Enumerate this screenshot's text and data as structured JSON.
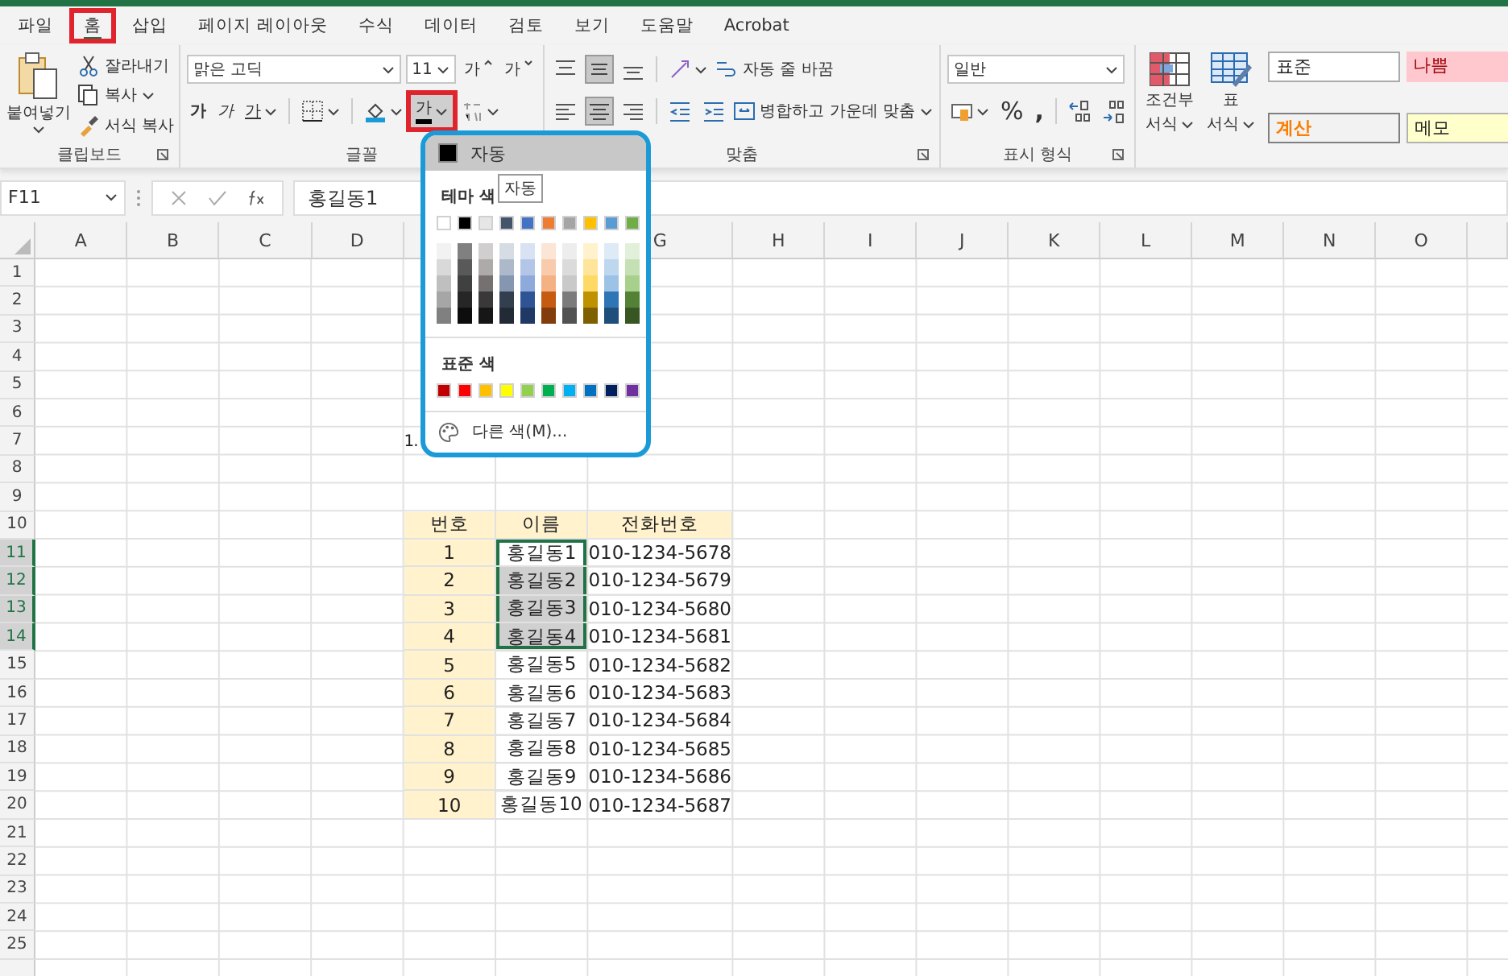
{
  "menu_tabs": [
    {
      "label": "파일",
      "selected": false
    },
    {
      "label": "홈",
      "selected": true
    },
    {
      "label": "삽입",
      "selected": false
    },
    {
      "label": "페이지 레이아웃",
      "selected": false
    },
    {
      "label": "수식",
      "selected": false
    },
    {
      "label": "데이터",
      "selected": false
    },
    {
      "label": "검토",
      "selected": false
    },
    {
      "label": "보기",
      "selected": false
    },
    {
      "label": "도움말",
      "selected": false
    },
    {
      "label": "Acrobat",
      "selected": false
    }
  ],
  "clipboard": {
    "paste": "붙여넣기",
    "cut": "잘라내기",
    "copy": "복사",
    "format_painter": "서식 복사",
    "group_label": "클립보드"
  },
  "font": {
    "font_name": "맑은 고딕",
    "font_size": "11",
    "grow": "가",
    "shrink": "가",
    "bold": "가",
    "italic": "가",
    "underline": "가",
    "font_color": "가",
    "group_label": "글꼴"
  },
  "alignment": {
    "wrap_text": "자동 줄 바꿈",
    "merge": "병합하고 가운데 맞춤",
    "group_label": "맞춤"
  },
  "number": {
    "format": "일반",
    "percent": "%",
    "comma": ",",
    "group_label": "표시 형식"
  },
  "styles": {
    "conditional": [
      "조건부",
      "서식"
    ],
    "table": [
      "표",
      "서식"
    ],
    "cell_styles": [
      {
        "label": "표준",
        "kind": "normal"
      },
      {
        "label": "나쁨",
        "kind": "bad"
      },
      {
        "label": "계산",
        "kind": "calculation"
      },
      {
        "label": "메모",
        "kind": "note"
      }
    ]
  },
  "formula_bar": {
    "name_box": "F11",
    "formula": "홍길동1"
  },
  "sheet": {
    "columns": [
      "A",
      "B",
      "C",
      "D",
      "G",
      "H",
      "I",
      "J",
      "K",
      "L",
      "M",
      "N",
      "O"
    ],
    "row_numbers": [
      "1",
      "2",
      "3",
      "4",
      "5",
      "6",
      "7",
      "8",
      "9",
      "10",
      "11",
      "12",
      "13",
      "14",
      "15",
      "16",
      "17",
      "18",
      "19",
      "20",
      "21",
      "22",
      "23",
      "24",
      "25"
    ],
    "stray_text": "1.",
    "table": {
      "header": [
        "번호",
        "이름",
        "전화번호"
      ],
      "rows": [
        {
          "cells": [
            "1",
            "홍길동1",
            "010-1234-5678"
          ],
          "selected": true
        },
        {
          "cells": [
            "2",
            "홍길동2",
            "010-1234-5679"
          ],
          "selected": true
        },
        {
          "cells": [
            "3",
            "홍길동3",
            "010-1234-5680"
          ],
          "selected": true
        },
        {
          "cells": [
            "4",
            "홍길동4",
            "010-1234-5681"
          ],
          "selected": true
        },
        {
          "cells": [
            "5",
            "홍길동5",
            "010-1234-5682"
          ],
          "selected": false
        },
        {
          "cells": [
            "6",
            "홍길동6",
            "010-1234-5683"
          ],
          "selected": false
        },
        {
          "cells": [
            "7",
            "홍길동7",
            "010-1234-5684"
          ],
          "selected": false
        },
        {
          "cells": [
            "8",
            "홍길동8",
            "010-1234-5685"
          ],
          "selected": false
        },
        {
          "cells": [
            "9",
            "홍길동9",
            "010-1234-5686"
          ],
          "selected": false
        },
        {
          "cells": [
            "10",
            "홍길동10",
            "010-1234-5687"
          ],
          "selected": false
        }
      ]
    }
  },
  "color_menu": {
    "automatic": "자동",
    "theme_heading": "테마 색",
    "tooltip": "자동",
    "theme_colors": [
      {
        "color": "#ffffff",
        "shades": [
          {
            "color": "#f2f2f2"
          },
          {
            "color": "#d9d9d9"
          },
          {
            "color": "#bfbfbf"
          },
          {
            "color": "#a6a6a6"
          },
          {
            "color": "#808080"
          }
        ]
      },
      {
        "color": "#000000",
        "shades": [
          {
            "color": "#808080"
          },
          {
            "color": "#595959"
          },
          {
            "color": "#404040"
          },
          {
            "color": "#262626"
          },
          {
            "color": "#0d0d0d"
          }
        ]
      },
      {
        "color": "#e7e6e6",
        "shades": [
          {
            "color": "#d0cece"
          },
          {
            "color": "#aeaaaa"
          },
          {
            "color": "#757171"
          },
          {
            "color": "#3a3838"
          },
          {
            "color": "#171616"
          }
        ]
      },
      {
        "color": "#44546a",
        "shades": [
          {
            "color": "#d6dce4"
          },
          {
            "color": "#adb9ca"
          },
          {
            "color": "#8496b0"
          },
          {
            "color": "#333f4f"
          },
          {
            "color": "#222a35"
          }
        ]
      },
      {
        "color": "#4472c4",
        "shades": [
          {
            "color": "#d9e2f3"
          },
          {
            "color": "#b4c6e7"
          },
          {
            "color": "#8eaadb"
          },
          {
            "color": "#2f5496"
          },
          {
            "color": "#1f3864"
          }
        ]
      },
      {
        "color": "#ed7d31",
        "shades": [
          {
            "color": "#fbe5d5"
          },
          {
            "color": "#f7cbac"
          },
          {
            "color": "#f4b183"
          },
          {
            "color": "#c55a11"
          },
          {
            "color": "#833c0b"
          }
        ]
      },
      {
        "color": "#a5a5a5",
        "shades": [
          {
            "color": "#ededed"
          },
          {
            "color": "#dbdbdb"
          },
          {
            "color": "#c9c9c9"
          },
          {
            "color": "#7b7b7b"
          },
          {
            "color": "#525252"
          }
        ]
      },
      {
        "color": "#ffc000",
        "shades": [
          {
            "color": "#fff2cc"
          },
          {
            "color": "#fee599"
          },
          {
            "color": "#ffd965"
          },
          {
            "color": "#bf9000"
          },
          {
            "color": "#7f6000"
          }
        ]
      },
      {
        "color": "#5b9bd5",
        "shades": [
          {
            "color": "#deebf6"
          },
          {
            "color": "#bdd7ee"
          },
          {
            "color": "#9cc3e5"
          },
          {
            "color": "#2e75b5"
          },
          {
            "color": "#1e4e79"
          }
        ]
      },
      {
        "color": "#70ad47",
        "shades": [
          {
            "color": "#e2efd9"
          },
          {
            "color": "#c5e0b3"
          },
          {
            "color": "#a8d08d"
          },
          {
            "color": "#538135"
          },
          {
            "color": "#375623"
          }
        ]
      }
    ],
    "standard_heading": "표준 색",
    "standard_colors": [
      {
        "color": "#c00000"
      },
      {
        "color": "#ff0000"
      },
      {
        "color": "#ffc000"
      },
      {
        "color": "#ffff00"
      },
      {
        "color": "#92d050"
      },
      {
        "color": "#00b050"
      },
      {
        "color": "#00b0f0"
      },
      {
        "color": "#0070c0"
      },
      {
        "color": "#002060"
      },
      {
        "color": "#7030a0"
      }
    ],
    "more_colors": "다른 색(M)..."
  }
}
